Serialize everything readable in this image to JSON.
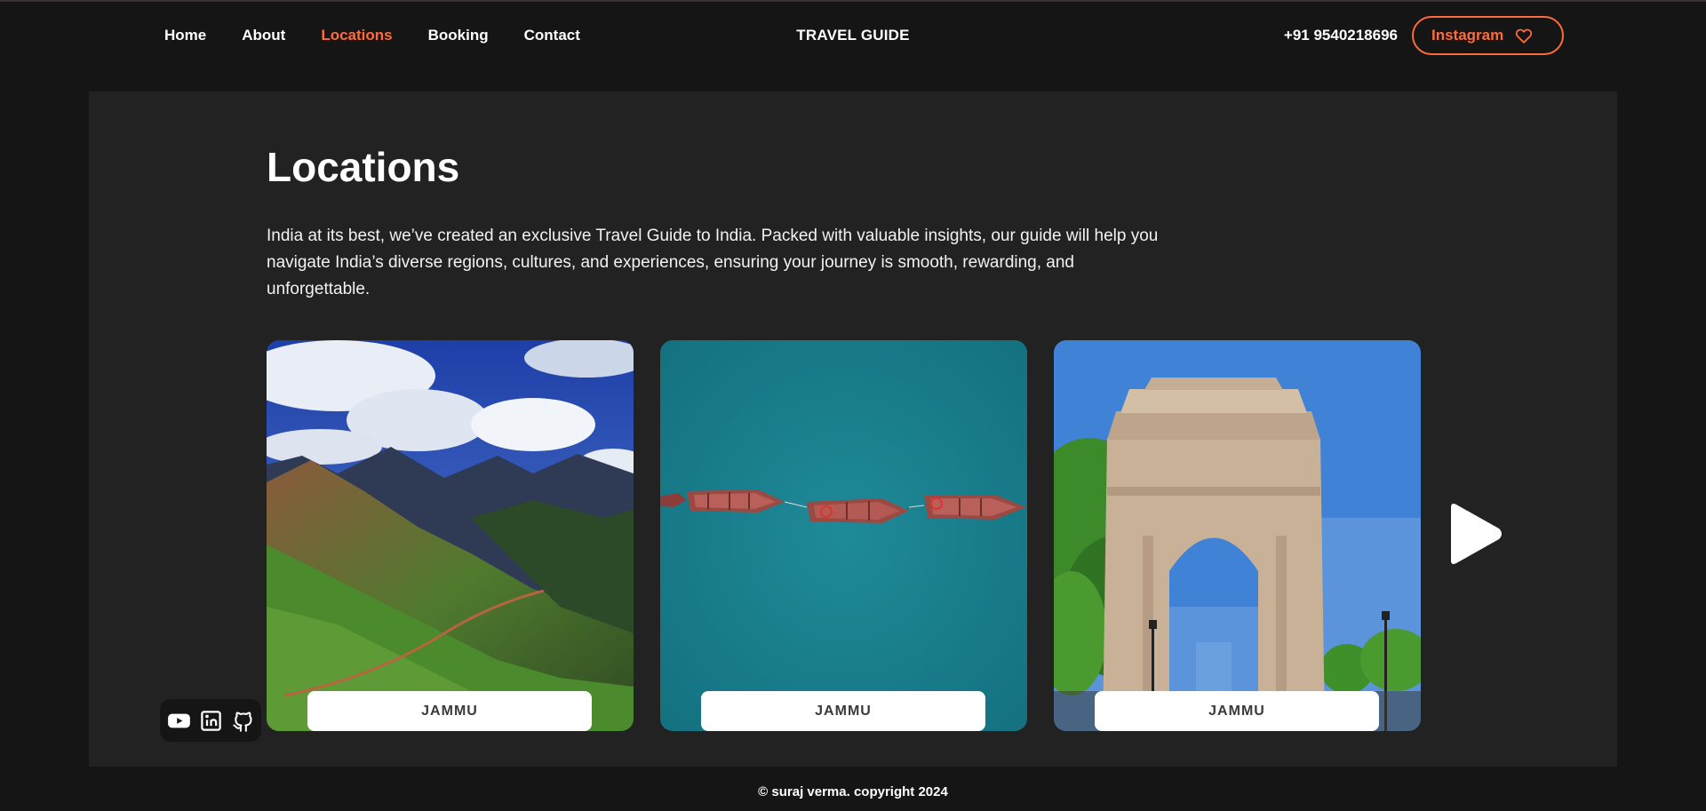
{
  "nav": {
    "links": [
      {
        "label": "Home"
      },
      {
        "label": "About"
      },
      {
        "label": "Locations",
        "active": true
      },
      {
        "label": "Booking"
      },
      {
        "label": "Contact"
      }
    ],
    "brand": "TRAVEL GUIDE",
    "phone": "+91 9540218696",
    "instagram_label": "Instagram",
    "instagram_icon": "heart-icon"
  },
  "main": {
    "title": "Locations",
    "intro": "India at its best, we’ve created an exclusive Travel Guide to India. Packed with valuable insights, our guide will help you navigate India’s diverse regions, cultures, and experiences, ensuring your journey is smooth, rewarding, and unforgettable.",
    "cards": [
      {
        "label": "JAMMU",
        "image": "mountain-valley-photo"
      },
      {
        "label": "JAMMU",
        "image": "boats-on-lake-photo"
      },
      {
        "label": "JAMMU",
        "image": "india-gate-photo"
      }
    ],
    "next_icon": "play-arrow-icon"
  },
  "socials": [
    {
      "icon": "youtube-icon"
    },
    {
      "icon": "linkedin-icon"
    },
    {
      "icon": "github-icon"
    }
  ],
  "footer": {
    "copyright": "© suraj verma. copyright 2024"
  },
  "colors": {
    "accent": "#ff6a3d",
    "background": "#151515",
    "panel": "#222222",
    "text": "#ffffff"
  }
}
